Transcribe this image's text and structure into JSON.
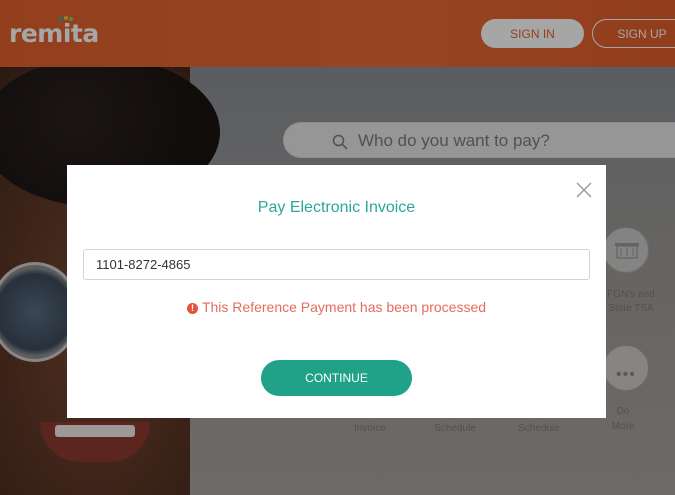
{
  "header": {
    "logo": "remita",
    "sign_in": "SIGN IN",
    "sign_up": "SIGN UP"
  },
  "search": {
    "placeholder": "Who do you want to pay?"
  },
  "background_items": {
    "fgn_line1": "FGN's and",
    "fgn_line2": "State TSA",
    "invoice": "Invoice",
    "schedule1": "Schedule",
    "schedule2": "Schedule",
    "do": "Do",
    "more": "More"
  },
  "modal": {
    "title": "Pay Electronic Invoice",
    "input_value": "1101-8272-4865",
    "error_icon": "!",
    "error_message": "This Reference Payment has been processed",
    "continue_label": "CONTINUE"
  },
  "colors": {
    "brand_orange": "#e2622f",
    "teal_title": "#2aa79c",
    "continue_green": "#20a288",
    "error_red": "#e36d5b"
  }
}
